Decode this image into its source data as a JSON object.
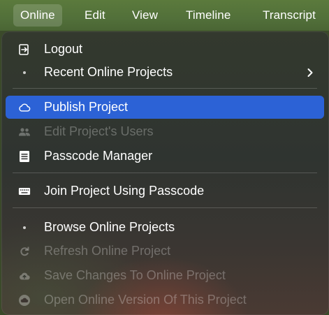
{
  "menubar": {
    "items": [
      {
        "label": "Online",
        "active": true
      },
      {
        "label": "Edit"
      },
      {
        "label": "View"
      },
      {
        "label": "Timeline"
      },
      {
        "label": "Transcript"
      }
    ]
  },
  "menu": {
    "items": [
      {
        "label": "Logout",
        "icon": "logout-icon",
        "enabled": true
      },
      {
        "label": "Recent Online Projects",
        "icon": "bullet-icon",
        "enabled": true,
        "submenu": true
      },
      {
        "label": "Publish Project",
        "icon": "cloud-icon",
        "enabled": true,
        "highlighted": true
      },
      {
        "label": "Edit Project's Users",
        "icon": "users-icon",
        "enabled": false
      },
      {
        "label": "Passcode Manager",
        "icon": "list-icon",
        "enabled": true
      },
      {
        "label": "Join Project Using Passcode",
        "icon": "keyboard-icon",
        "enabled": true
      },
      {
        "label": "Browse Online Projects",
        "icon": "bullet-icon",
        "enabled": true
      },
      {
        "label": "Refresh Online Project",
        "icon": "refresh-icon",
        "enabled": false
      },
      {
        "label": "Save Changes To Online Project",
        "icon": "cloud-upload-icon",
        "enabled": false
      },
      {
        "label": "Open Online Version Of This Project",
        "icon": "cloud-open-icon",
        "enabled": false
      }
    ]
  },
  "colors": {
    "menubar": "#52703a",
    "highlight": "#2c62d6",
    "text": "#ffffff"
  }
}
